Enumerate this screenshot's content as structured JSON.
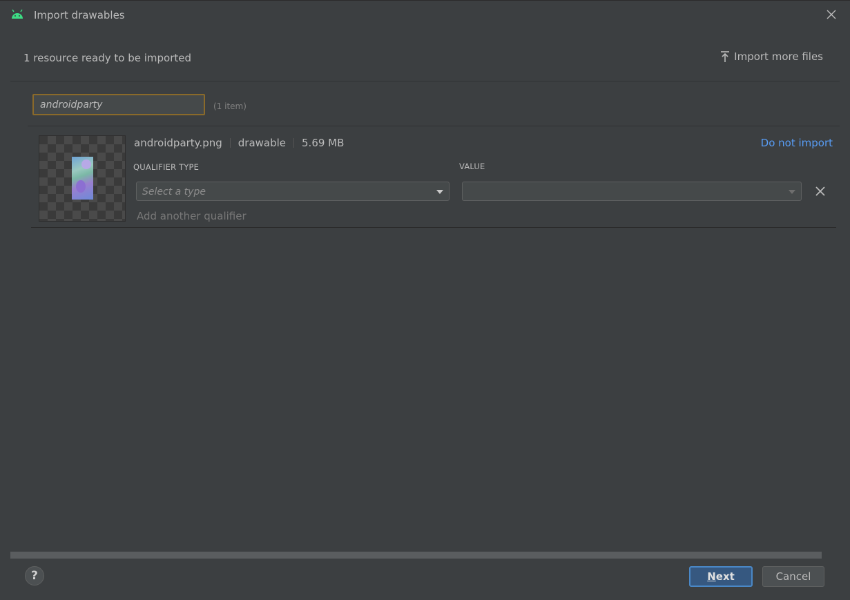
{
  "window": {
    "title": "Import drawables",
    "app_icon": "android-icon",
    "close_icon": "close-icon"
  },
  "header": {
    "status": "1 resource ready to be imported",
    "import_more_label": "Import more files",
    "import_more_icon": "upload-icon"
  },
  "search": {
    "value": "androidparty",
    "count": "(1 item)"
  },
  "resource": {
    "filename": "androidparty.png",
    "type": "drawable",
    "size": "5.69 MB",
    "do_not_import": "Do not import",
    "qualifier_type_header": "QUALIFIER TYPE",
    "value_header": "VALUE",
    "qualifier_placeholder": "Select a type",
    "value_selected": "",
    "add_qualifier": "Add another qualifier"
  },
  "footer": {
    "help": "?",
    "next_mnemonic": "N",
    "next_rest": "ext",
    "cancel": "Cancel"
  },
  "colors": {
    "background": "#3c3f41",
    "link": "#589df6",
    "primary_button": "#365880",
    "android_green": "#3ddc84"
  }
}
